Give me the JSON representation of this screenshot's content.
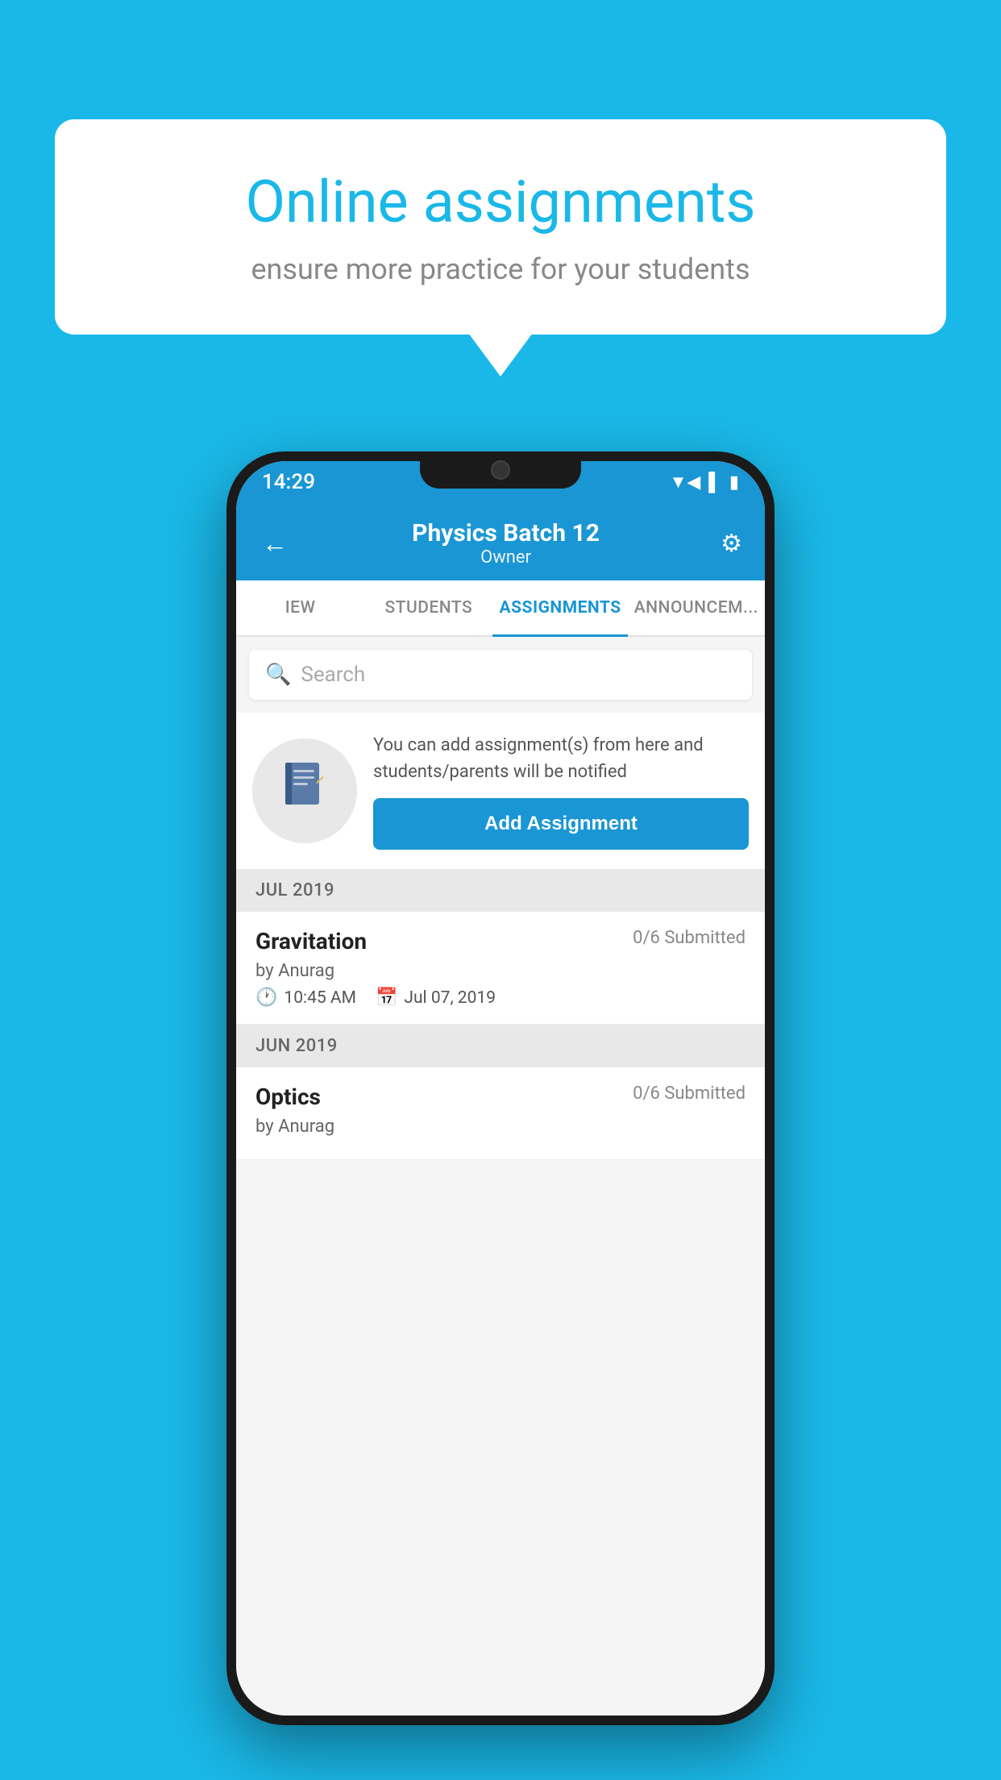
{
  "background": {
    "color": "#1ab8e8"
  },
  "speech_bubble": {
    "title": "Online assignments",
    "subtitle": "ensure more practice for your students"
  },
  "phone": {
    "status_bar": {
      "time": "14:29",
      "icons": [
        "wifi",
        "signal",
        "battery"
      ]
    },
    "header": {
      "title": "Physics Batch 12",
      "subtitle": "Owner",
      "back_label": "←",
      "settings_label": "⚙"
    },
    "tabs": [
      {
        "label": "IEW",
        "active": false
      },
      {
        "label": "STUDENTS",
        "active": false
      },
      {
        "label": "ASSIGNMENTS",
        "active": true
      },
      {
        "label": "ANNOUNCEM...",
        "active": false
      }
    ],
    "search": {
      "placeholder": "Search"
    },
    "add_assignment_promo": {
      "description": "You can add assignment(s) from here and students/parents will be notified",
      "button_label": "Add Assignment"
    },
    "sections": [
      {
        "month": "JUL 2019",
        "assignments": [
          {
            "name": "Gravitation",
            "submitted": "0/6 Submitted",
            "by": "by Anurag",
            "time": "10:45 AM",
            "date": "Jul 07, 2019"
          }
        ]
      },
      {
        "month": "JUN 2019",
        "assignments": [
          {
            "name": "Optics",
            "submitted": "0/6 Submitted",
            "by": "by Anurag",
            "time": "",
            "date": ""
          }
        ]
      }
    ]
  }
}
